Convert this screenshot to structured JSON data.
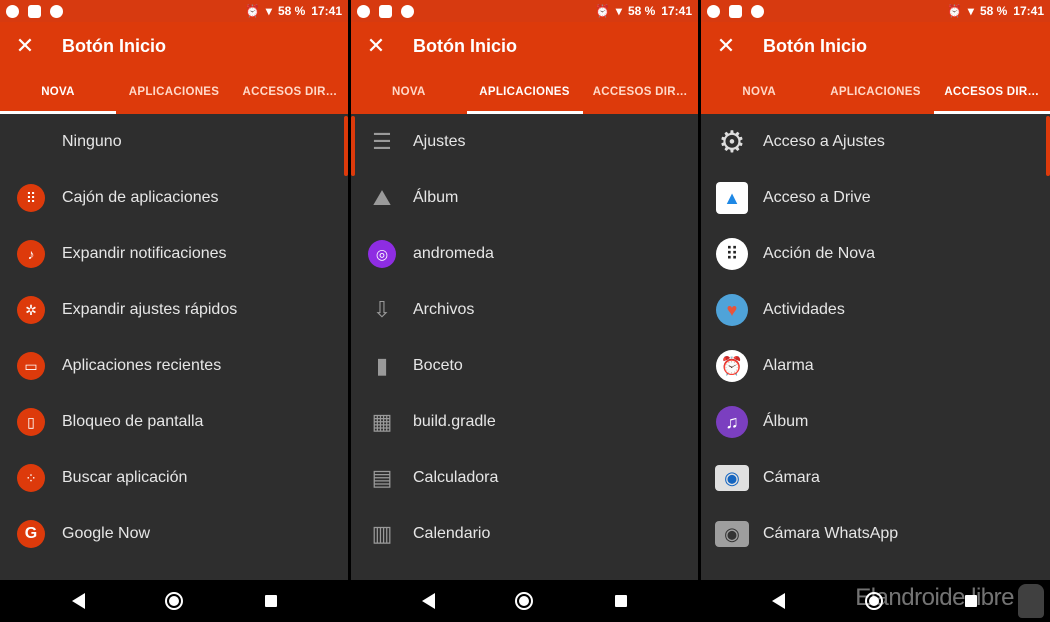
{
  "status": {
    "battery": "58 %",
    "time": "17:41"
  },
  "appbar": {
    "title": "Botón Inicio",
    "close": "✕"
  },
  "tabs": [
    "NOVA",
    "APLICACIONES",
    "ACCESOS DIR…"
  ],
  "panel1": {
    "items": [
      {
        "label": "Ninguno",
        "icon": "none"
      },
      {
        "label": "Cajón de aplicaciones",
        "icon": "app-drawer-icon"
      },
      {
        "label": "Expandir notificaciones",
        "icon": "bell-icon"
      },
      {
        "label": "Expandir ajustes rápidos",
        "icon": "gear-icon"
      },
      {
        "label": "Aplicaciones recientes",
        "icon": "recents-icon"
      },
      {
        "label": "Bloqueo de pantalla",
        "icon": "phone-lock-icon"
      },
      {
        "label": "Buscar aplicación",
        "icon": "search-apps-icon"
      },
      {
        "label": "Google Now",
        "icon": "google-icon"
      }
    ]
  },
  "panel2": {
    "items": [
      {
        "label": "Ajustes",
        "icon": "sliders-icon"
      },
      {
        "label": "Álbum",
        "icon": "image-icon"
      },
      {
        "label": "andromeda",
        "icon": "andromeda-icon"
      },
      {
        "label": "Archivos",
        "icon": "download-arrow-icon"
      },
      {
        "label": "Boceto",
        "icon": "marker-icon"
      },
      {
        "label": "build.gradle",
        "icon": "qr-icon"
      },
      {
        "label": "Calculadora",
        "icon": "calculator-icon"
      },
      {
        "label": "Calendario",
        "icon": "calendar-icon"
      }
    ]
  },
  "panel3": {
    "items": [
      {
        "label": "Acceso a Ajustes",
        "icon": "settings-gear-icon"
      },
      {
        "label": "Acceso a Drive",
        "icon": "drive-icon"
      },
      {
        "label": "Acción de Nova",
        "icon": "nova-dots-icon"
      },
      {
        "label": "Actividades",
        "icon": "activities-icon"
      },
      {
        "label": "Alarma",
        "icon": "alarm-icon"
      },
      {
        "label": "Álbum",
        "icon": "music-icon"
      },
      {
        "label": "Cámara",
        "icon": "camera-icon"
      },
      {
        "label": "Cámara WhatsApp",
        "icon": "whatsapp-camera-icon"
      }
    ]
  },
  "watermark": "Elandroide libre",
  "colors": {
    "accent": "#dd3a0b",
    "background": "#2e2e2e"
  }
}
